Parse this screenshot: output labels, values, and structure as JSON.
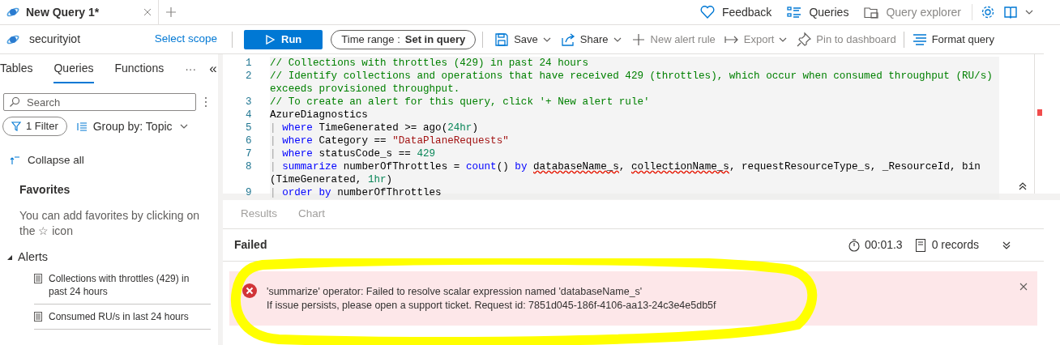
{
  "tabs": [
    {
      "label": "New Query 1*",
      "selected": true
    }
  ],
  "top_actions": [
    {
      "label": "Feedback",
      "kind": "heart",
      "disabled": false
    },
    {
      "label": "Queries",
      "kind": "list",
      "disabled": false
    },
    {
      "label": "Query explorer",
      "kind": "explorer",
      "disabled": true
    }
  ],
  "scope": {
    "name": "securityiot",
    "link": "Select scope"
  },
  "toolbar": {
    "run": "Run",
    "time_range_label": "Time range :",
    "time_range_value": "Set in query",
    "actions": [
      {
        "label": "Save",
        "kind": "save",
        "dropdown": true,
        "disabled": false
      },
      {
        "label": "Share",
        "kind": "share",
        "dropdown": true,
        "disabled": false
      },
      {
        "label": "New alert rule",
        "kind": "plus",
        "dropdown": false,
        "disabled": true
      },
      {
        "label": "Export",
        "kind": "export",
        "dropdown": true,
        "disabled": true
      },
      {
        "label": "Pin to dashboard",
        "kind": "pin",
        "dropdown": false,
        "disabled": true
      },
      {
        "label": "Format query",
        "kind": "format",
        "dropdown": false,
        "disabled": false
      }
    ]
  },
  "sidebar": {
    "tabs": [
      {
        "label": "Tables",
        "selected": false
      },
      {
        "label": "Queries",
        "selected": true
      },
      {
        "label": "Functions",
        "selected": false
      }
    ],
    "more": "···",
    "collapse": "«",
    "search": {
      "placeholder": "Search"
    },
    "filter": "1 Filter",
    "group_by": "Group by: Topic",
    "collapse_all": "Collapse all",
    "favorites_title": "Favorites",
    "favorites_hint": "You can add favorites by clicking on the ☆ icon",
    "groups": [
      {
        "label": "Alerts",
        "expanded": true,
        "children": [
          {
            "label": "Collections with throttles (429) in past 24 hours"
          },
          {
            "label": "Consumed RU/s in last 24 hours"
          }
        ]
      }
    ]
  },
  "editor": {
    "lines": [
      {
        "number": "1",
        "tokens": [
          {
            "kind": "comment",
            "text": "// Collections with throttles (429) in past 24 hours"
          }
        ]
      },
      {
        "number": "2",
        "tokens": [
          {
            "kind": "comment",
            "text": "// Identify collections and operations that have received 429 (throttles), which occur when consumed throughput (RU/s) exceeds provisioned throughput."
          }
        ]
      },
      {
        "number": "3",
        "tokens": [
          {
            "kind": "comment",
            "text": "// To create an alert for this query, click '+ New alert rule'"
          }
        ]
      },
      {
        "number": "4",
        "tokens": [
          {
            "kind": "plain",
            "text": "AzureDiagnostics"
          }
        ]
      },
      {
        "number": "5",
        "tokens": [
          {
            "kind": "pipe",
            "text": "| "
          },
          {
            "kind": "keyword",
            "text": "where"
          },
          {
            "kind": "plain",
            "text": " TimeGenerated >= ago("
          },
          {
            "kind": "number",
            "text": "24hr"
          },
          {
            "kind": "plain",
            "text": ")"
          }
        ]
      },
      {
        "number": "6",
        "tokens": [
          {
            "kind": "pipe",
            "text": "| "
          },
          {
            "kind": "keyword",
            "text": "where"
          },
          {
            "kind": "plain",
            "text": " Category == "
          },
          {
            "kind": "string",
            "text": "\"DataPlaneRequests\""
          }
        ]
      },
      {
        "number": "7",
        "tokens": [
          {
            "kind": "pipe",
            "text": "| "
          },
          {
            "kind": "keyword",
            "text": "where"
          },
          {
            "kind": "plain",
            "text": " statusCode_s == "
          },
          {
            "kind": "number",
            "text": "429"
          }
        ]
      },
      {
        "number": "8",
        "tokens": [
          {
            "kind": "pipe",
            "text": "| "
          },
          {
            "kind": "keyword",
            "text": "summarize"
          },
          {
            "kind": "plain",
            "text": " numberOfThrottles = "
          },
          {
            "kind": "keyword",
            "text": "count"
          },
          {
            "kind": "plain",
            "text": "() "
          },
          {
            "kind": "keyword",
            "text": "by "
          },
          {
            "kind": "error",
            "text": "databaseName_s"
          },
          {
            "kind": "plain",
            "text": ", "
          },
          {
            "kind": "error",
            "text": "collectionName_s"
          },
          {
            "kind": "plain",
            "text": ", requestResourceType_s, _ResourceId, bin (TimeGenerated, "
          },
          {
            "kind": "number",
            "text": "1hr"
          },
          {
            "kind": "plain",
            "text": ")"
          }
        ]
      },
      {
        "number": "9",
        "tokens": [
          {
            "kind": "pipe",
            "text": "| "
          },
          {
            "kind": "keyword",
            "text": "order by"
          },
          {
            "kind": "plain",
            "text": " numberOfThrottles"
          }
        ]
      }
    ]
  },
  "results": {
    "tabs": [
      {
        "label": "Results",
        "selected": false
      },
      {
        "label": "Chart",
        "selected": false
      }
    ],
    "status": "Failed",
    "duration": "00:01.3",
    "records": "0 records",
    "error": {
      "message": "'summarize' operator: Failed to resolve scalar expression named 'databaseName_s'",
      "detail": "If issue persists, please open a support ticket. Request id: 7851d045-186f-4106-aa13-24c3e4e5db5f"
    }
  },
  "annotations": [
    {
      "kind": "ring"
    }
  ]
}
